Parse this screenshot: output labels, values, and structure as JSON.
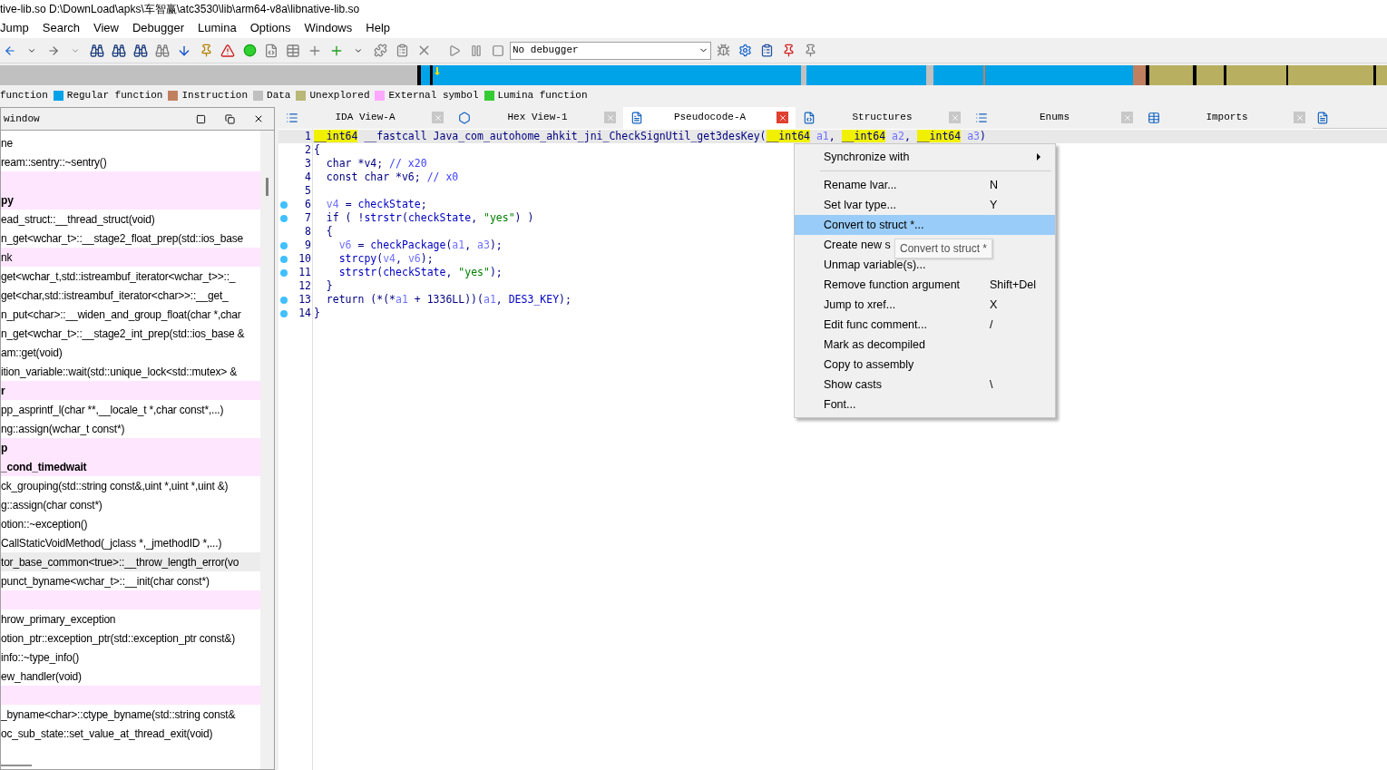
{
  "window": {
    "title": "tive-lib.so D:\\DownLoad\\apks\\车智赢\\atc3530\\lib\\arm64-v8a\\libnative-lib.so"
  },
  "menu_bar": [
    "Jump",
    "Search",
    "View",
    "Debugger",
    "Lumina",
    "Options",
    "Windows",
    "Help"
  ],
  "toolbar": {
    "debugger_select": "No debugger"
  },
  "legend": [
    {
      "label": "function"
    },
    {
      "label": "Regular function",
      "color": "#00a2e8"
    },
    {
      "label": "Instruction",
      "color": "#c08060"
    },
    {
      "label": "Data",
      "color": "#c0c0c0"
    },
    {
      "label": "Unexplored",
      "color": "#b8b878"
    },
    {
      "label": "External symbol",
      "color": "#ffa8ff"
    },
    {
      "label": "Lumina function",
      "color": "#33cc33"
    }
  ],
  "functions_panel": {
    "title": "window",
    "rows": [
      {
        "text": "ne",
        "kind": "regular",
        "bold": false,
        "selected": false
      },
      {
        "text": "ream::sentry::~sentry()",
        "kind": "regular",
        "bold": false,
        "selected": false
      },
      {
        "kind": "external",
        "selected": false
      },
      {
        "text": "py",
        "kind": "external",
        "bold": true,
        "selected": false
      },
      {
        "text": "ead_struct::__thread_struct(void)",
        "kind": "regular",
        "bold": false,
        "selected": false
      },
      {
        "text": "n_get<wchar_t>::__stage2_float_prep(std::ios_base",
        "kind": "regular",
        "bold": false,
        "selected": false
      },
      {
        "text": "nk",
        "kind": "external",
        "bold": false,
        "selected": false
      },
      {
        "text": "get<wchar_t,std::istreambuf_iterator<wchar_t>>::_",
        "kind": "regular",
        "bold": false,
        "selected": false
      },
      {
        "text": "get<char,std::istreambuf_iterator<char>>::__get_",
        "kind": "regular",
        "bold": false,
        "selected": false
      },
      {
        "text": "n_put<char>::__widen_and_group_float(char *,char",
        "kind": "regular",
        "bold": false,
        "selected": false
      },
      {
        "text": "n_get<wchar_t>::__stage2_int_prep(std::ios_base &",
        "kind": "regular",
        "bold": false,
        "selected": false
      },
      {
        "text": "am::get(void)",
        "kind": "regular",
        "bold": false,
        "selected": false
      },
      {
        "text": "ition_variable::wait(std::unique_lock<std::mutex> &",
        "kind": "regular",
        "bold": false,
        "selected": false
      },
      {
        "text": "r",
        "kind": "external",
        "bold": true,
        "selected": false
      },
      {
        "text": "pp_asprintf_l(char **,__locale_t *,char const*,...)",
        "kind": "regular",
        "bold": false,
        "selected": false
      },
      {
        "text": "ng::assign(wchar_t const*)",
        "kind": "regular",
        "bold": false,
        "selected": false
      },
      {
        "text": "p",
        "kind": "external",
        "bold": true,
        "selected": false
      },
      {
        "text": "_cond_timedwait",
        "kind": "external",
        "bold": true,
        "selected": false
      },
      {
        "text": "ck_grouping(std::string const&,uint *,uint *,uint &)",
        "kind": "regular",
        "bold": false,
        "selected": false
      },
      {
        "text": "g::assign(char const*)",
        "kind": "regular",
        "bold": false,
        "selected": false
      },
      {
        "text": "otion::~exception()",
        "kind": "regular",
        "bold": false,
        "selected": false
      },
      {
        "text": "CallStaticVoidMethod(_jclass *,_jmethodID *,...)",
        "kind": "regular",
        "bold": false,
        "selected": false
      },
      {
        "text": "tor_base_common<true>::__throw_length_error(vo",
        "kind": "regular",
        "bold": false,
        "selected": true
      },
      {
        "text": "punct_byname<wchar_t>::__init(char const*)",
        "kind": "regular",
        "bold": false,
        "selected": false
      },
      {
        "kind": "external",
        "selected": false
      },
      {
        "text": "hrow_primary_exception",
        "kind": "regular",
        "bold": false,
        "selected": false
      },
      {
        "text": "otion_ptr::exception_ptr(std::exception_ptr const&)",
        "kind": "regular",
        "bold": false,
        "selected": false
      },
      {
        "text": "info::~type_info()",
        "kind": "regular",
        "bold": false,
        "selected": false
      },
      {
        "text": "ew_handler(void)",
        "kind": "regular",
        "bold": false,
        "selected": false
      },
      {
        "kind": "external",
        "selected": false
      },
      {
        "text": "_byname<char>::ctype_byname(std::string const&",
        "kind": "regular",
        "bold": false,
        "selected": false
      },
      {
        "text": "oc_sub_state::set_value_at_thread_exit(void)",
        "kind": "regular",
        "bold": false,
        "selected": false
      }
    ]
  },
  "tabs": [
    {
      "label": "IDA View-A",
      "selected": false
    },
    {
      "label": "Hex View-1",
      "selected": false
    },
    {
      "label": "Pseudocode-A",
      "selected": true
    },
    {
      "label": "Structures",
      "selected": false
    },
    {
      "label": "Enums",
      "selected": false
    },
    {
      "label": "Imports",
      "selected": false
    }
  ],
  "code": [
    {
      "number": "1",
      "dot": false,
      "current": true,
      "tokens": [
        {
          "kind": "hl",
          "text": "__int64"
        },
        {
          "kind": "plain",
          "text": " __fastcall Java_com_autohome_ahkit_jni_CheckSignUtil_get3desKey("
        },
        {
          "kind": "hl",
          "text": "__int64"
        },
        {
          "kind": "var",
          "text": " a1"
        },
        {
          "kind": "plain",
          "text": ", "
        },
        {
          "kind": "hl",
          "text": "__int64"
        },
        {
          "kind": "var",
          "text": " a2"
        },
        {
          "kind": "plain",
          "text": ", "
        },
        {
          "kind": "hl",
          "text": "__int64"
        },
        {
          "kind": "var",
          "text": " a3"
        },
        {
          "kind": "plain",
          "text": ")"
        }
      ]
    },
    {
      "number": "2",
      "dot": false,
      "current": false,
      "tokens": [
        {
          "kind": "plain",
          "text": "{"
        }
      ]
    },
    {
      "number": "3",
      "dot": false,
      "current": false,
      "tokens": [
        {
          "kind": "plain",
          "text": "  char *v4; "
        },
        {
          "kind": "cmt",
          "text": "// x20"
        }
      ]
    },
    {
      "number": "4",
      "dot": false,
      "current": false,
      "tokens": [
        {
          "kind": "plain",
          "text": "  const char *v6; "
        },
        {
          "kind": "cmt",
          "text": "// x0"
        }
      ]
    },
    {
      "number": "5",
      "dot": false,
      "current": false
    },
    {
      "number": "6",
      "dot": true,
      "current": false,
      "tokens": [
        {
          "kind": "var",
          "text": "  v4"
        },
        {
          "kind": "plain",
          "text": " = "
        },
        {
          "kind": "fn",
          "text": "checkState"
        },
        {
          "kind": "plain",
          "text": ";"
        }
      ]
    },
    {
      "number": "7",
      "dot": true,
      "current": false,
      "tokens": [
        {
          "kind": "plain",
          "text": "  if ( !"
        },
        {
          "kind": "fn",
          "text": "strstr"
        },
        {
          "kind": "plain",
          "text": "("
        },
        {
          "kind": "fn",
          "text": "checkState"
        },
        {
          "kind": "plain",
          "text": ", "
        },
        {
          "kind": "str",
          "text": "\"yes\""
        },
        {
          "kind": "plain",
          "text": ") )"
        }
      ]
    },
    {
      "number": "8",
      "dot": false,
      "current": false,
      "tokens": [
        {
          "kind": "plain",
          "text": "  {"
        }
      ]
    },
    {
      "number": "9",
      "dot": true,
      "current": false,
      "tokens": [
        {
          "kind": "var",
          "text": "    v6"
        },
        {
          "kind": "plain",
          "text": " = "
        },
        {
          "kind": "fn",
          "text": "checkPackage"
        },
        {
          "kind": "plain",
          "text": "("
        },
        {
          "kind": "var",
          "text": "a1"
        },
        {
          "kind": "plain",
          "text": ", "
        },
        {
          "kind": "var",
          "text": "a3"
        },
        {
          "kind": "plain",
          "text": ");"
        }
      ]
    },
    {
      "number": "10",
      "dot": true,
      "current": false,
      "tokens": [
        {
          "kind": "fn",
          "text": "    strcpy"
        },
        {
          "kind": "plain",
          "text": "("
        },
        {
          "kind": "var",
          "text": "v4"
        },
        {
          "kind": "plain",
          "text": ", "
        },
        {
          "kind": "var",
          "text": "v6"
        },
        {
          "kind": "plain",
          "text": ");"
        }
      ]
    },
    {
      "number": "11",
      "dot": true,
      "current": false,
      "tokens": [
        {
          "kind": "fn",
          "text": "    strstr"
        },
        {
          "kind": "plain",
          "text": "("
        },
        {
          "kind": "fn",
          "text": "checkState"
        },
        {
          "kind": "plain",
          "text": ", "
        },
        {
          "kind": "str",
          "text": "\"yes\""
        },
        {
          "kind": "plain",
          "text": ");"
        }
      ]
    },
    {
      "number": "12",
      "dot": false,
      "current": false,
      "tokens": [
        {
          "kind": "plain",
          "text": "  }"
        }
      ]
    },
    {
      "number": "13",
      "dot": true,
      "current": false,
      "tokens": [
        {
          "kind": "plain",
          "text": "  return (*(*"
        },
        {
          "kind": "var",
          "text": "a1"
        },
        {
          "kind": "plain",
          "text": " + 1336LL))("
        },
        {
          "kind": "var",
          "text": "a1"
        },
        {
          "kind": "plain",
          "text": ", "
        },
        {
          "kind": "fn",
          "text": "DES3_KEY"
        },
        {
          "kind": "plain",
          "text": ");"
        }
      ]
    },
    {
      "number": "14",
      "dot": true,
      "current": false,
      "tokens": [
        {
          "kind": "plain",
          "text": "}"
        }
      ]
    }
  ],
  "context_menu": {
    "items": [
      {
        "label": "Synchronize with",
        "submenu": true,
        "selected": false,
        "separator_after": true
      },
      {
        "label": "Rename lvar...",
        "shortcut": "N",
        "submenu": false,
        "selected": false,
        "separator_after": false
      },
      {
        "label": "Set lvar type...",
        "shortcut": "Y",
        "submenu": false,
        "selected": false,
        "separator_after": false
      },
      {
        "label": "Convert to struct *...",
        "submenu": false,
        "selected": true,
        "separator_after": false
      },
      {
        "label": "Create new s",
        "submenu": false,
        "selected": false,
        "separator_after": false
      },
      {
        "label": "Unmap variable(s)...",
        "submenu": false,
        "selected": false,
        "separator_after": false
      },
      {
        "label": "Remove function argument",
        "shortcut": "Shift+Del",
        "submenu": false,
        "selected": false,
        "separator_after": false
      },
      {
        "label": "Jump to xref...",
        "shortcut": "X",
        "submenu": false,
        "selected": false,
        "separator_after": false
      },
      {
        "label": "Edit func comment...",
        "shortcut": "/",
        "submenu": false,
        "selected": false,
        "separator_after": false
      },
      {
        "label": "Mark as decompiled",
        "submenu": false,
        "selected": false,
        "separator_after": false
      },
      {
        "label": "Copy to assembly",
        "submenu": false,
        "selected": false,
        "separator_after": false
      },
      {
        "label": "Show casts",
        "shortcut": "\\",
        "submenu": false,
        "selected": false,
        "separator_after": false
      },
      {
        "label": "Font...",
        "submenu": false,
        "selected": false,
        "separator_after": false
      }
    ],
    "tooltip": "Convert to struct *"
  }
}
